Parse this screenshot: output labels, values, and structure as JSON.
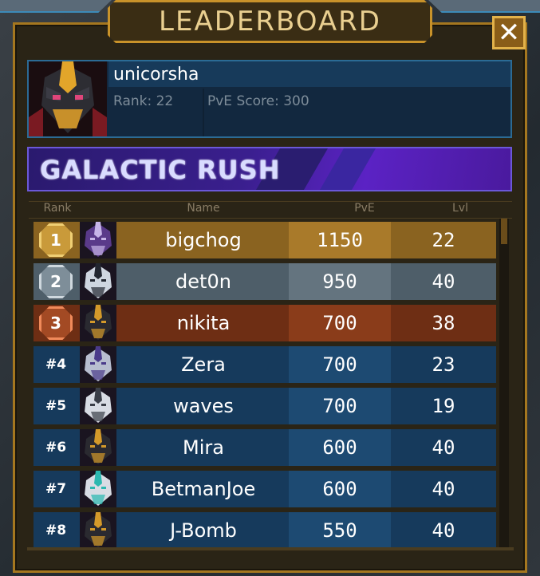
{
  "header": {
    "title": "LEADERBOARD",
    "close_icon": "close-icon"
  },
  "player": {
    "name": "unicorsha",
    "rank_text": "Rank: 22",
    "score_text": "PvE Score: 300"
  },
  "event": {
    "title": "GALACTIC RUSH"
  },
  "table": {
    "columns": [
      "Rank",
      "Name",
      "PvE",
      "Lvl"
    ],
    "rows": [
      {
        "rank": "1",
        "name": "bigchog",
        "pve": "1150",
        "lvl": "22",
        "style": "gold"
      },
      {
        "rank": "2",
        "name": "det0n",
        "pve": "950",
        "lvl": "40",
        "style": "silver"
      },
      {
        "rank": "3",
        "name": "nikita",
        "pve": "700",
        "lvl": "38",
        "style": "bronze"
      },
      {
        "rank": "#4",
        "name": "Zera",
        "pve": "700",
        "lvl": "23",
        "style": "blue"
      },
      {
        "rank": "#5",
        "name": "waves",
        "pve": "700",
        "lvl": "19",
        "style": "blue"
      },
      {
        "rank": "#6",
        "name": "Mira",
        "pve": "600",
        "lvl": "40",
        "style": "blue"
      },
      {
        "rank": "#7",
        "name": "BetmanJoe",
        "pve": "600",
        "lvl": "40",
        "style": "blue"
      },
      {
        "rank": "#8",
        "name": "J-Bomb",
        "pve": "550",
        "lvl": "40",
        "style": "blue"
      }
    ]
  },
  "colors": {
    "gold_row": "#8a6320",
    "gold_cell": "#a97a2a",
    "silver_row": "#4e5e69",
    "silver_cell": "#64747f",
    "bronze_row": "#6e2e14",
    "bronze_cell": "#8a3c1a",
    "blue_row": "#163a5c",
    "blue_cell": "#1d4a72"
  }
}
